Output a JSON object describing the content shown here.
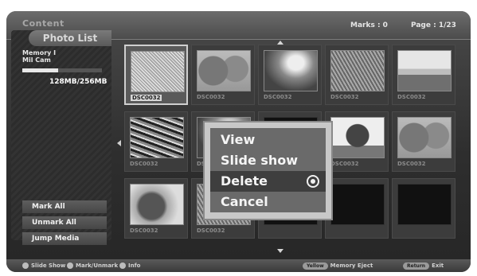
{
  "header": {
    "app_title": "Content",
    "mark_label": "Marks : 0",
    "page_label": "Page : 1/23"
  },
  "sidebar": {
    "title": "Photo List",
    "device_line1": "Memory I",
    "device_line2": "Mil Cam",
    "capacity_fraction": 0.45,
    "capacity_text": "128MB/256MB",
    "buttons": {
      "mark_all": "Mark All",
      "unmark_all": "Unmark All",
      "jump_media": "Jump Media"
    }
  },
  "grid": {
    "items": [
      {
        "label": "DSC0032",
        "thumb": "noise",
        "selected": true
      },
      {
        "label": "DSC0032",
        "thumb": "flowers"
      },
      {
        "label": "DSC0032",
        "thumb": "swirl"
      },
      {
        "label": "DSC0032",
        "thumb": "diag"
      },
      {
        "label": "DSC0032",
        "thumb": "land"
      },
      {
        "label": "DSC0032",
        "thumb": "branches"
      },
      {
        "label": "DSC0032",
        "thumb": "swirl"
      },
      {
        "label": "DSC0032",
        "thumb": "dark"
      },
      {
        "label": "DSC0032",
        "thumb": "tree"
      },
      {
        "label": "DSC0032",
        "thumb": "flowers"
      },
      {
        "label": "DSC0032",
        "thumb": "petal"
      },
      {
        "label": "DSC0032",
        "thumb": "diag"
      },
      {
        "label": "",
        "thumb": "dark"
      },
      {
        "label": "",
        "thumb": "dark"
      },
      {
        "label": "",
        "thumb": "dark"
      }
    ]
  },
  "context_menu": {
    "items": [
      "View",
      "Slide show",
      "Delete",
      "Cancel"
    ],
    "active_index": 2
  },
  "footer": {
    "slide_show": "Slide Show",
    "mark_unmark": "Mark/Unmark",
    "info": "Info",
    "eject_key": "Yellow",
    "eject": "Memory Eject",
    "exit_key": "Return",
    "exit": "Exit"
  }
}
